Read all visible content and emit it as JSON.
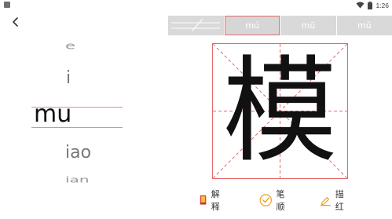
{
  "status_bar": {
    "time": "1:26"
  },
  "pinyin_list": [
    "e",
    "i",
    "mu",
    "iao",
    "ian"
  ],
  "tabs": [
    {
      "label": "",
      "selected": false
    },
    {
      "label": "mú",
      "selected": true
    },
    {
      "label": "mū",
      "selected": false
    },
    {
      "label": "mǔ",
      "selected": false
    }
  ],
  "character": "模",
  "actions": {
    "explain": "解释",
    "stroke_order": "笔顺",
    "trace": "描红"
  },
  "colors": {
    "tab_bg": "#d9d9d9",
    "grid_red": "#e26a6a",
    "icon_orange": "#f0a020",
    "book_red": "#e04a3a"
  },
  "icons": {
    "back": "chevron-left-icon",
    "explain": "book-icon",
    "stroke_order": "check-circle-icon",
    "trace": "pencil-icon"
  }
}
